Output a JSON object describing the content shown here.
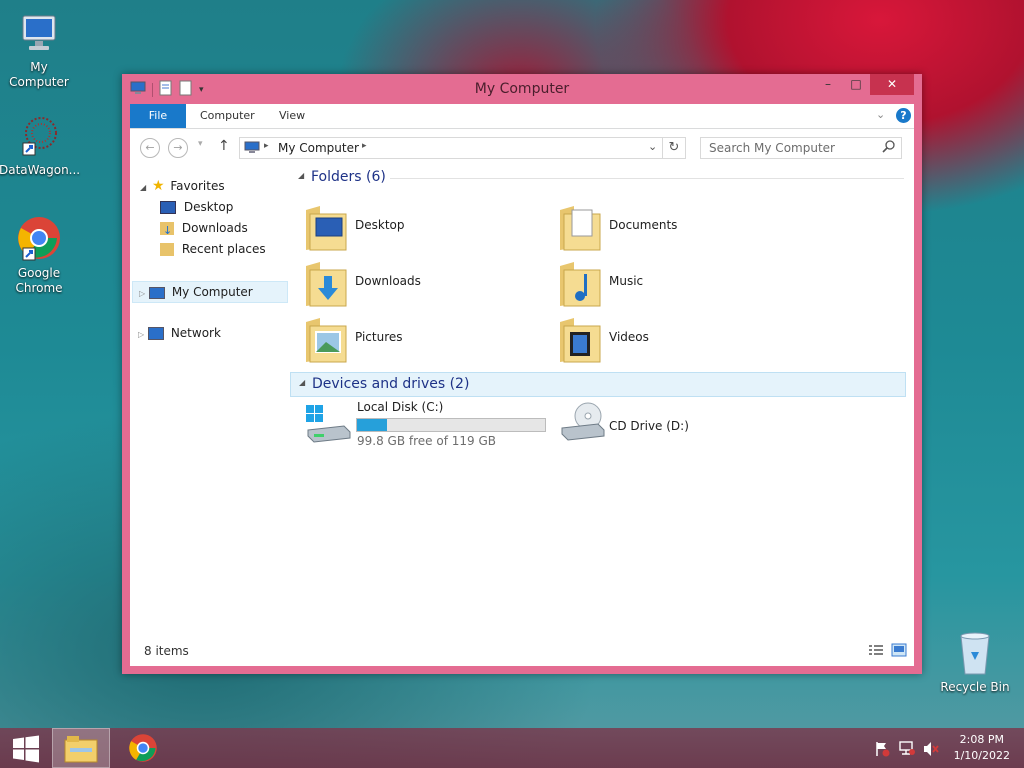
{
  "desktop": {
    "icons": [
      {
        "label": "My Computer"
      },
      {
        "label": "DataWagon..."
      },
      {
        "label": "Google Chrome"
      },
      {
        "label": "Recycle Bin"
      }
    ]
  },
  "window": {
    "title": "My Computer",
    "controls": {
      "minimize": "–",
      "maximize": "□",
      "close": "✕"
    },
    "ribbon_tabs": [
      "File",
      "Computer",
      "View"
    ],
    "address": {
      "path": "My Computer"
    },
    "search": {
      "placeholder": "Search My Computer"
    },
    "nav": {
      "favorites": "Favorites",
      "favorites_items": [
        "Desktop",
        "Downloads",
        "Recent places"
      ],
      "my_computer": "My Computer",
      "network": "Network"
    },
    "groups": {
      "folders": "Folders (6)",
      "devices": "Devices and drives (2)"
    },
    "folders": [
      "Desktop",
      "Documents",
      "Downloads",
      "Music",
      "Pictures",
      "Videos"
    ],
    "drives": [
      {
        "name": "Local Disk (C:)",
        "free_text": "99.8 GB free of 119 GB",
        "used_fraction": 0.16
      },
      {
        "name": "CD Drive (D:)"
      }
    ],
    "status": {
      "item_count": "8 items"
    }
  },
  "taskbar": {
    "time": "2:08 PM",
    "date": "1/10/2022"
  },
  "colors": {
    "window_frame": "#e46c92",
    "accent": "#1979ca",
    "close_button": "#c7324f",
    "group_header_text": "#1e3287"
  }
}
